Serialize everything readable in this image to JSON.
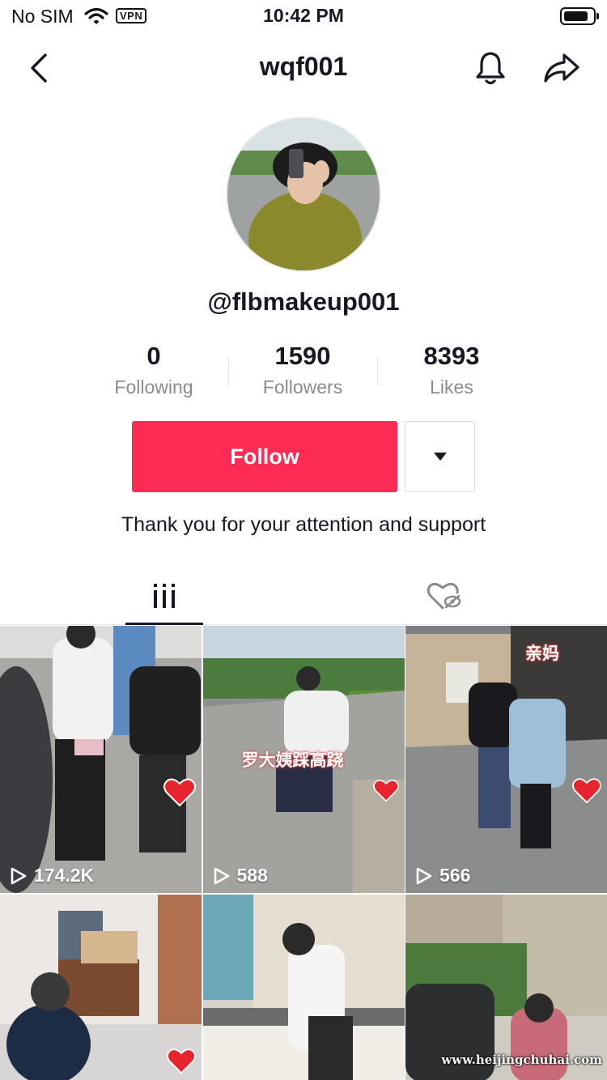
{
  "status_bar": {
    "carrier": "No SIM",
    "vpn": "VPN",
    "time": "10:42 PM",
    "battery_level": 0.85
  },
  "nav": {
    "title": "wqf001"
  },
  "profile": {
    "handle": "@flbmakeup001",
    "bio": "Thank you for your attention and support"
  },
  "stats": [
    {
      "value": "0",
      "label": "Following"
    },
    {
      "value": "1590",
      "label": "Followers"
    },
    {
      "value": "8393",
      "label": "Likes"
    }
  ],
  "actions": {
    "follow_label": "Follow"
  },
  "videos": [
    {
      "views": "174.2K",
      "caption": ""
    },
    {
      "views": "588",
      "caption": "罗大姨踩高跷"
    },
    {
      "views": "566",
      "caption": "亲妈"
    },
    {
      "views": "",
      "caption": ""
    },
    {
      "views": "",
      "caption": ""
    },
    {
      "views": "",
      "caption": ""
    }
  ],
  "watermark": "www.heijingchuhai.com",
  "colors": {
    "accent": "#fe2c55",
    "text": "#161823",
    "secondary": "#8a8b91"
  }
}
